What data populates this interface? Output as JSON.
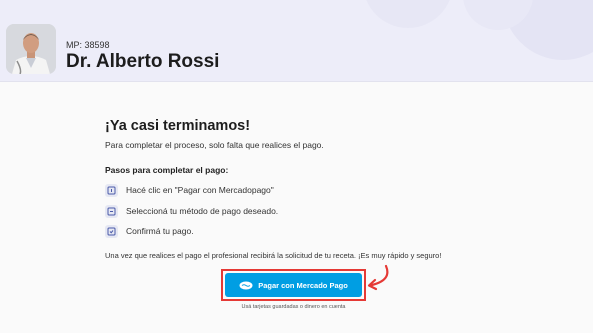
{
  "doctor": {
    "mp_label": "MP: 38598",
    "name": "Dr. Alberto Rossi"
  },
  "content": {
    "title": "¡Ya casi terminamos!",
    "subtitle": "Para completar el proceso, solo falta que realices el pago.",
    "steps_title": "Pasos para completar el pago:",
    "steps": [
      {
        "label": "Hacé clic en \"Pagar con Mercadopago\"",
        "icon": "step-icon"
      },
      {
        "label": "Seleccioná tu método de pago deseado.",
        "icon": "step-icon"
      },
      {
        "label": "Confirmá tu pago.",
        "icon": "step-icon"
      }
    ],
    "note": "Una vez que realices el pago el profesional recibirá la solicitud de tu receta. ¡Es muy rápido y seguro!"
  },
  "payment": {
    "button_label": "Pagar con Mercado Pago",
    "button_icon": "mercadopago-handshake-icon",
    "caption": "Usá tarjetas guardadas o dinero en cuenta",
    "button_color": "#009ee3",
    "highlight_color": "#e53935"
  }
}
